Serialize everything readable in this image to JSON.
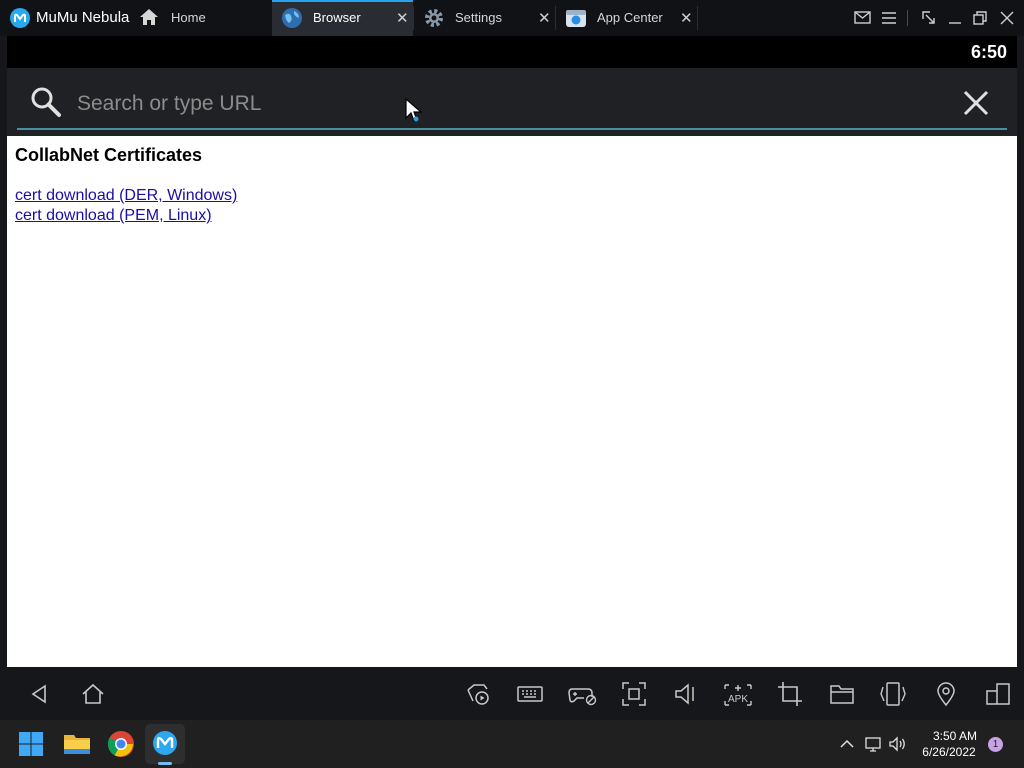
{
  "window": {
    "app_name": "MuMu Nebula",
    "home_label": "Home",
    "tabs": [
      {
        "label": "Browser",
        "icon": "globe-icon",
        "active": true
      },
      {
        "label": "Settings",
        "icon": "gear-icon",
        "active": false
      },
      {
        "label": "App Center",
        "icon": "app-center-icon",
        "active": false
      }
    ],
    "controls": [
      "mail-icon",
      "menu-icon",
      "resize-icon",
      "minimize-icon",
      "restore-icon",
      "close-icon"
    ]
  },
  "android": {
    "status_time": "6:50",
    "url_bar": {
      "placeholder": "Search or type URL",
      "value": ""
    },
    "page": {
      "heading": "CollabNet Certificates",
      "links": [
        {
          "text": "cert download (DER, Windows)"
        },
        {
          "text": "cert download (PEM, Linux)"
        }
      ]
    }
  },
  "toolbar": {
    "nav": [
      "back-icon",
      "home-icon"
    ],
    "tools": [
      "video-record-icon",
      "keyboard-icon",
      "gamepad-icon",
      "screen-fit-icon",
      "volume-icon",
      "apk-install-icon",
      "crop-icon",
      "folder-icon",
      "rotate-icon",
      "location-icon",
      "multi-window-icon"
    ],
    "apk_label": "APK"
  },
  "taskbar": {
    "apps": [
      "windows-start-icon",
      "file-explorer-icon",
      "chrome-icon",
      "mumu-icon"
    ],
    "clock_time": "3:50 AM",
    "clock_date": "6/26/2022",
    "notification_count": "1"
  },
  "colors": {
    "accent": "#25a3ee",
    "link": "#1a0dab",
    "titlebar_bg": "#111216",
    "active_tab_bg": "#2a2c33",
    "url_bar_bg": "#202124"
  }
}
